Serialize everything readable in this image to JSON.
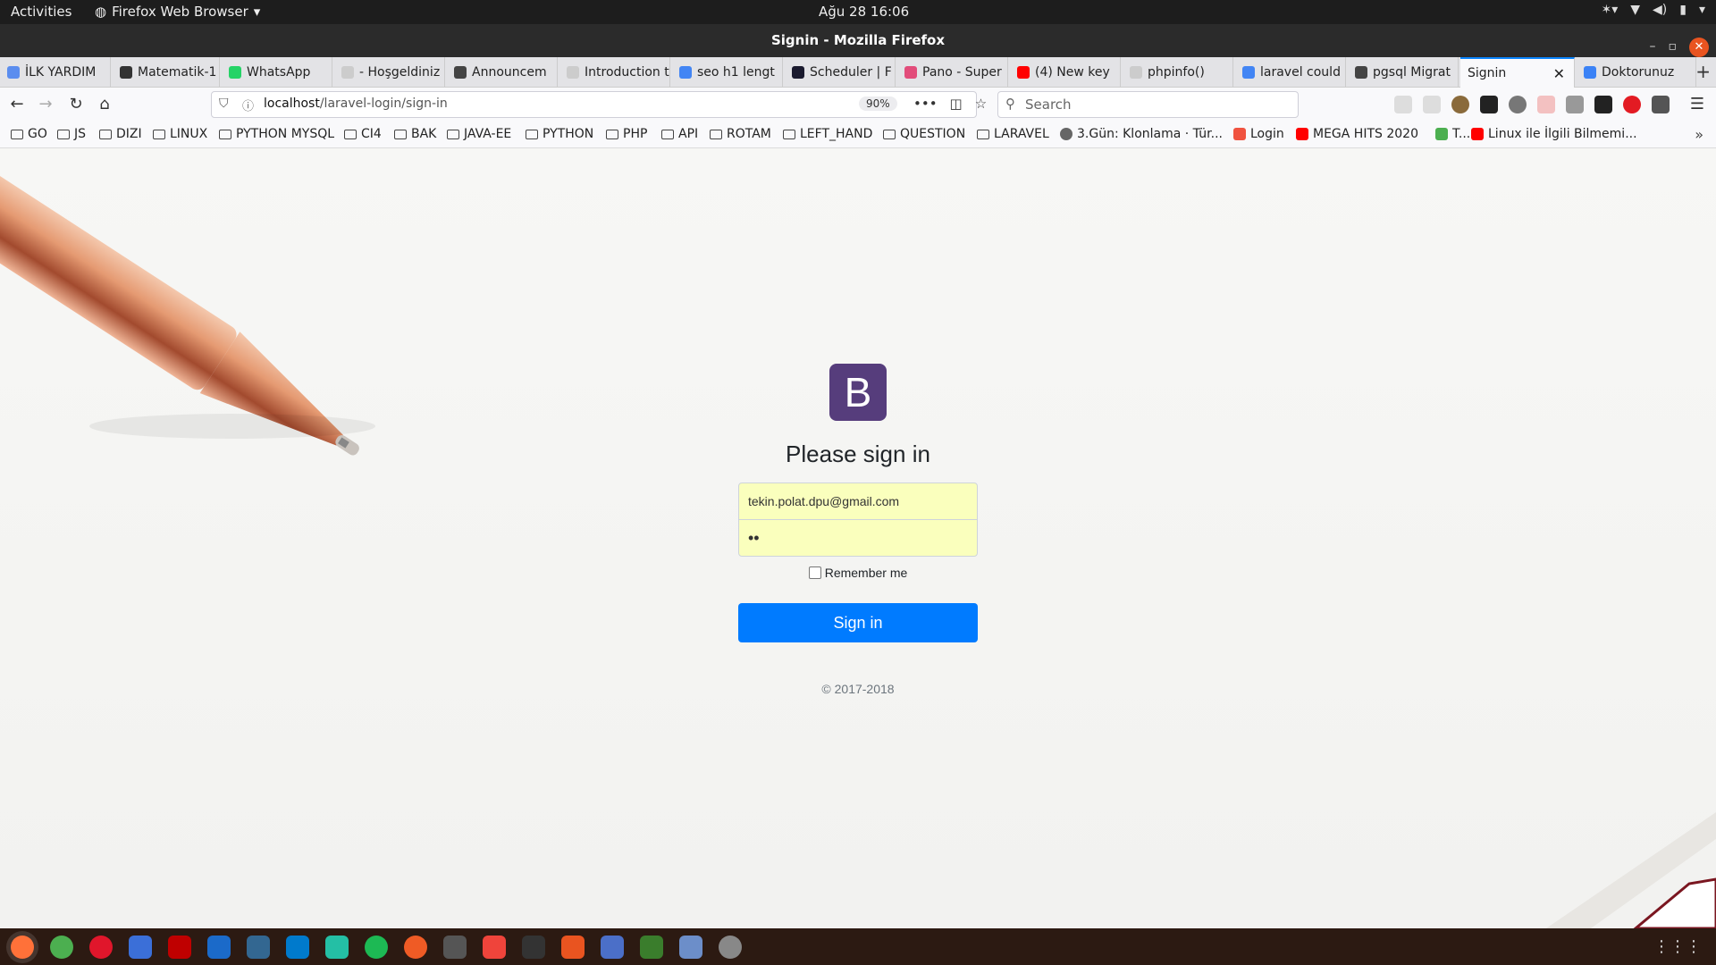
{
  "system": {
    "activities": "Activities",
    "app_name": "Firefox Web Browser",
    "clock": "Ağu 28  16:06"
  },
  "window": {
    "title": "Signin - Mozilla Firefox"
  },
  "tabs": [
    {
      "label": "İLK YARDIM",
      "icon": "user-icon",
      "color": "#5b8def"
    },
    {
      "label": "Matematik-1",
      "icon": "plus-minus-icon",
      "color": "#333333"
    },
    {
      "label": "WhatsApp",
      "icon": "whatsapp-icon",
      "color": "#25d366"
    },
    {
      "label": "- Hoşgeldiniz - A",
      "icon": "blank-icon",
      "color": "#cccccc"
    },
    {
      "label": "Announcem",
      "icon": "square-icon",
      "color": "#444444"
    },
    {
      "label": "Introduction to",
      "icon": "blank-icon",
      "color": "#cccccc"
    },
    {
      "label": "seo h1 lengt",
      "icon": "google-icon",
      "color": "#4285f4"
    },
    {
      "label": "Scheduler | F",
      "icon": "s-icon",
      "color": "#1a1a2e"
    },
    {
      "label": "Pano - Super",
      "icon": "s-circle-icon",
      "color": "#e24c7a"
    },
    {
      "label": "(4) New key",
      "icon": "youtube-icon",
      "color": "#ff0000"
    },
    {
      "label": "phpinfo()",
      "icon": "blank-icon",
      "color": "#cccccc"
    },
    {
      "label": "laravel could",
      "icon": "google-icon",
      "color": "#4285f4"
    },
    {
      "label": "pgsql Migrat",
      "icon": "paper-plane-icon",
      "color": "#444444"
    },
    {
      "label": "Signin",
      "icon": "none",
      "color": "#f9f9fb",
      "active": true
    },
    {
      "label": "Doktorunuz",
      "icon": "du-icon",
      "color": "#3b82f6"
    }
  ],
  "nav": {
    "url_host": "localhost",
    "url_path": "/laravel-login/sign-in",
    "zoom": "90%",
    "search_placeholder": "Search"
  },
  "bookmarks": [
    {
      "label": "GO",
      "type": "folder"
    },
    {
      "label": "JS",
      "type": "folder"
    },
    {
      "label": "DIZI",
      "type": "folder"
    },
    {
      "label": "LINUX",
      "type": "folder"
    },
    {
      "label": "PYTHON MYSQL",
      "type": "folder"
    },
    {
      "label": "CI4",
      "type": "folder"
    },
    {
      "label": "BAK",
      "type": "folder"
    },
    {
      "label": "JAVA-EE",
      "type": "folder"
    },
    {
      "label": "PYTHON",
      "type": "folder"
    },
    {
      "label": "PHP",
      "type": "folder"
    },
    {
      "label": "API",
      "type": "folder"
    },
    {
      "label": "ROTAM",
      "type": "folder"
    },
    {
      "label": "LEFT_HAND",
      "type": "folder"
    },
    {
      "label": "QUESTION",
      "type": "folder"
    },
    {
      "label": "LARAVEL",
      "type": "folder"
    },
    {
      "label": "3.Gün: Klonlama · Tür...",
      "type": "link",
      "icon": "globe-icon"
    },
    {
      "label": "Login",
      "type": "link",
      "icon": "laravel-icon"
    },
    {
      "label": "MEGA HITS 2020 ",
      "type": "link",
      "icon": "youtube-icon"
    },
    {
      "label": "T...",
      "type": "link",
      "icon": "sprout-icon"
    },
    {
      "label": "Linux ile İlgili Bilmemi...",
      "type": "link",
      "icon": "youtube-icon"
    }
  ],
  "signin": {
    "logo_letter": "B",
    "heading": "Please sign in",
    "email_value": "tekin.polat.dpu@gmail.com",
    "password_value": "••",
    "remember_label": "Remember me",
    "remember_checked": false,
    "button_label": "Sign in",
    "copyright": "© 2017-2018"
  },
  "dock": [
    {
      "name": "firefox-icon",
      "color": "#ff7139"
    },
    {
      "name": "chrome-icon",
      "color": "#4caf50"
    },
    {
      "name": "opera-icon",
      "color": "#e0162b"
    },
    {
      "name": "text-editor-icon",
      "color": "#3b6fd8"
    },
    {
      "name": "filezilla-icon",
      "color": "#bf0000"
    },
    {
      "name": "netbeans-icon",
      "color": "#1b6ac9"
    },
    {
      "name": "postgres-icon",
      "color": "#336791"
    },
    {
      "name": "vscode-icon",
      "color": "#007acc"
    },
    {
      "name": "vscode-insiders-icon",
      "color": "#24bfa5"
    },
    {
      "name": "spotify-icon",
      "color": "#1db954"
    },
    {
      "name": "postman-icon",
      "color": "#ef5b25"
    },
    {
      "name": "system-monitor-icon",
      "color": "#555555"
    },
    {
      "name": "anydesk-icon",
      "color": "#ef443b"
    },
    {
      "name": "terminal-icon",
      "color": "#333333"
    },
    {
      "name": "software-center-icon",
      "color": "#e95420"
    },
    {
      "name": "teams-icon",
      "color": "#4b6fc8"
    },
    {
      "name": "inkscape-icon",
      "color": "#3a7d2c"
    },
    {
      "name": "notes-icon",
      "color": "#6c8ec9"
    },
    {
      "name": "settings-wheel-icon",
      "color": "#888888"
    }
  ]
}
